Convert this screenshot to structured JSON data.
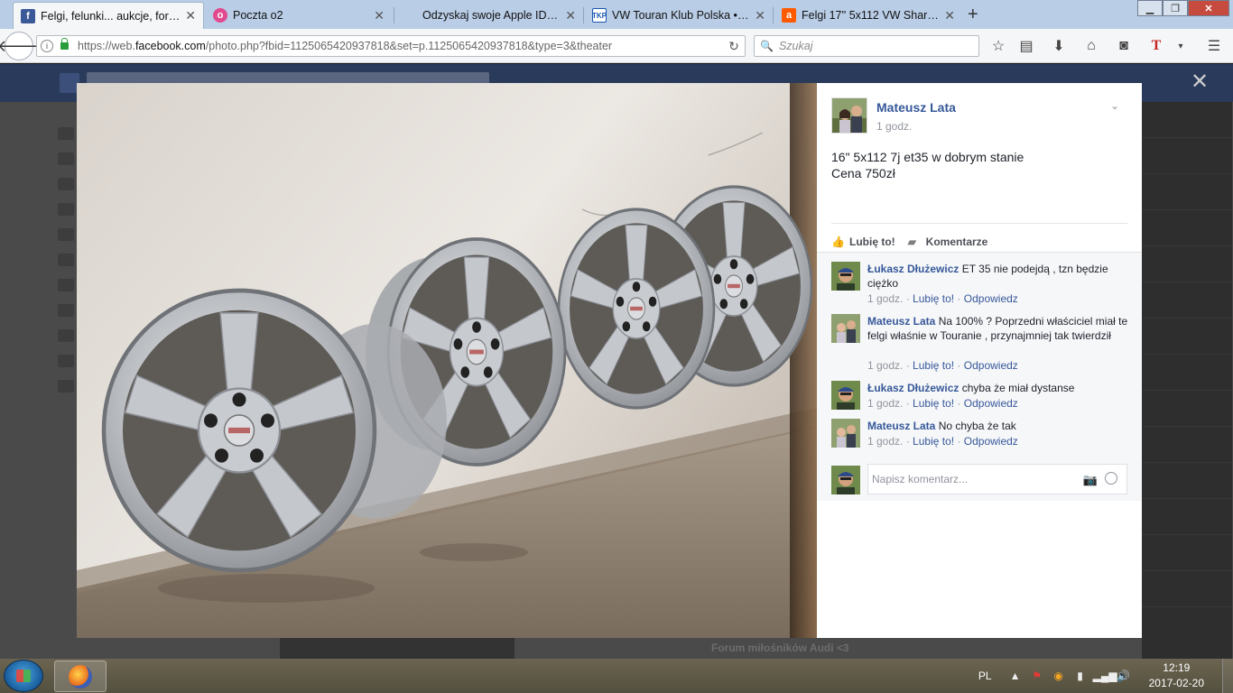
{
  "browser": {
    "tabs": [
      {
        "title": "Felgi, felunki... aukcje, fora,...",
        "favicon": "facebook-icon",
        "active": true
      },
      {
        "title": "Poczta o2",
        "favicon": "o2-mail-icon",
        "active": false
      },
      {
        "title": "Odzyskaj swoje Apple ID —...",
        "favicon": "apple-icon",
        "active": false
      },
      {
        "title": "VW Touran Klub Polska • Z...",
        "favicon": "tkp-icon",
        "active": false
      },
      {
        "title": "Felgi 17'' 5x112 VW Sharan ...",
        "favicon": "allegro-icon",
        "active": false
      }
    ],
    "url_prefix": "https://web.",
    "url_domain": "facebook.com",
    "url_rest": "/photo.php?fbid=1125065420937818&set=p.1125065420937818&type=3&theater",
    "search_placeholder": "Szukaj"
  },
  "post": {
    "author": "Mateusz Lata",
    "time": "1 godz.",
    "text_line1": "16\" 5x112 7j et35 w dobrym stanie",
    "text_line2": "Cena 750zł",
    "like_label": "Lubię to!",
    "comment_label": "Komentarze"
  },
  "comments": [
    {
      "name": "Łukasz Dłużewicz",
      "text": "ET 35 nie podejdą , tzn będzie ciężko",
      "time": "1 godz.",
      "like": "Lubię to!",
      "reply": "Odpowiedz"
    },
    {
      "name": "Mateusz Lata",
      "text": "Na 100% ? Poprzedni właściciel miał te felgi właśnie w Touranie , przynajmniej tak twierdził",
      "time": "1 godz.",
      "like": "Lubię to!",
      "reply": "Odpowiedz"
    },
    {
      "name": "Łukasz Dłużewicz",
      "text": "chyba że miał dystanse",
      "time": "1 godz.",
      "like": "Lubię to!",
      "reply": "Odpowiedz"
    },
    {
      "name": "Mateusz Lata",
      "text": "No chyba że tak",
      "time": "1 godz.",
      "like": "Lubię to!",
      "reply": "Odpowiedz"
    }
  ],
  "comment_input_placeholder": "Napisz komentarz...",
  "background_page": {
    "footer_text": "Forum miłośników Audi <3"
  },
  "taskbar": {
    "language": "PL",
    "time": "12:19",
    "date": "2017-02-20"
  },
  "colors": {
    "facebook_link": "#365899",
    "tab_strip": "#b9cde6",
    "overlay_dark": "#1a1a1a"
  }
}
